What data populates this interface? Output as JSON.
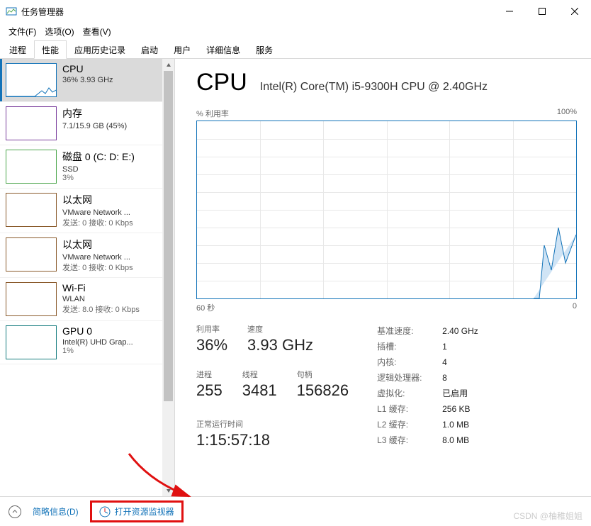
{
  "window": {
    "title": "任务管理器"
  },
  "menu": {
    "file": "文件(F)",
    "options": "选项(O)",
    "view": "查看(V)"
  },
  "tabs": [
    "进程",
    "性能",
    "应用历史记录",
    "启动",
    "用户",
    "详细信息",
    "服务"
  ],
  "active_tab": 1,
  "sidebar": {
    "items": [
      {
        "title": "CPU",
        "sub": "36% 3.93 GHz",
        "type": "cpu"
      },
      {
        "title": "内存",
        "sub": "7.1/15.9 GB (45%)",
        "type": "mem"
      },
      {
        "title": "磁盘 0 (C: D: E:)",
        "sub": "SSD",
        "sub2": "3%",
        "type": "disk"
      },
      {
        "title": "以太网",
        "sub": "VMware Network ...",
        "sub2": "发送: 0 接收: 0 Kbps",
        "type": "net"
      },
      {
        "title": "以太网",
        "sub": "VMware Network ...",
        "sub2": "发送: 0 接收: 0 Kbps",
        "type": "net"
      },
      {
        "title": "Wi-Fi",
        "sub": "WLAN",
        "sub2": "发送: 8.0 接收: 0 Kbps",
        "type": "net"
      },
      {
        "title": "GPU 0",
        "sub": "Intel(R) UHD Grap...",
        "sub2": "1%",
        "type": "gpu"
      }
    ]
  },
  "cpu": {
    "heading": "CPU",
    "model": "Intel(R) Core(TM) i5-9300H CPU @ 2.40GHz",
    "chart": {
      "ylabel": "% 利用率",
      "ymax": "100%",
      "xlabel_left": "60 秒",
      "xlabel_right": "0"
    },
    "stats": {
      "util_label": "利用率",
      "util": "36%",
      "speed_label": "速度",
      "speed": "3.93 GHz",
      "proc_label": "进程",
      "proc": "255",
      "threads_label": "线程",
      "threads": "3481",
      "handles_label": "句柄",
      "handles": "156826",
      "uptime_label": "正常运行时间",
      "uptime": "1:15:57:18"
    },
    "info": {
      "base_speed_k": "基准速度:",
      "base_speed_v": "2.40 GHz",
      "sockets_k": "插槽:",
      "sockets_v": "1",
      "cores_k": "内核:",
      "cores_v": "4",
      "lp_k": "逻辑处理器:",
      "lp_v": "8",
      "virt_k": "虚拟化:",
      "virt_v": "已启用",
      "l1_k": "L1 缓存:",
      "l1_v": "256 KB",
      "l2_k": "L2 缓存:",
      "l2_v": "1.0 MB",
      "l3_k": "L3 缓存:",
      "l3_v": "8.0 MB"
    }
  },
  "footer": {
    "brief": "简略信息(D)",
    "resmon": "打开资源监视器"
  },
  "watermark": "CSDN @柚稚姐姐",
  "chart_data": {
    "type": "line",
    "title": "% 利用率",
    "xlabel": "60 秒",
    "ylabel": "% 利用率",
    "ylim": [
      0,
      100
    ],
    "x": [
      60,
      55,
      50,
      45,
      40,
      35,
      30,
      25,
      20,
      15,
      10,
      5,
      4,
      3,
      2,
      1,
      0
    ],
    "values": [
      0,
      0,
      0,
      0,
      0,
      0,
      0,
      0,
      0,
      0,
      0,
      0,
      30,
      15,
      40,
      20,
      36
    ]
  }
}
